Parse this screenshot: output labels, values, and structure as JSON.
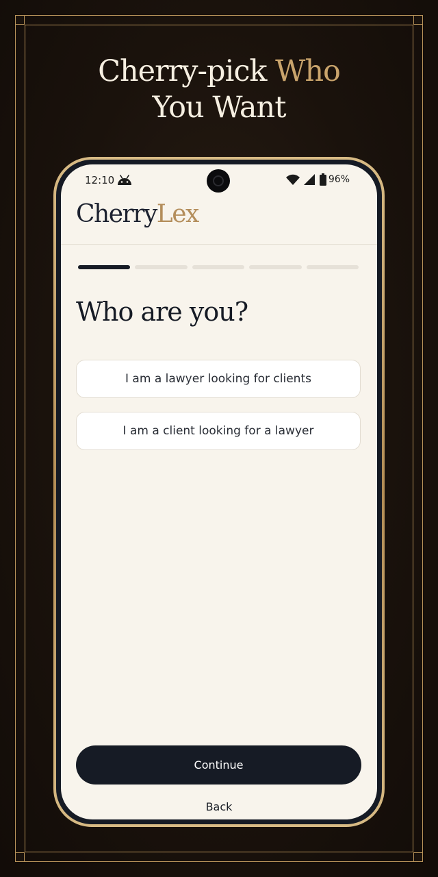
{
  "promo": {
    "headline_part1": "Cherry-pick",
    "headline_part2": "Who",
    "headline_line2": "You Want"
  },
  "status_bar": {
    "time": "12:10",
    "battery": "96%",
    "icons": [
      "android-icon",
      "wifi-icon",
      "cellular-signal-icon",
      "battery-icon"
    ]
  },
  "app": {
    "logo_part1": "Cherry",
    "logo_part2": "Lex",
    "progress": {
      "current_step": 1,
      "total_steps": 5
    },
    "question": "Who are you?",
    "options": [
      "I am a lawyer looking for clients",
      "I am a client looking for a lawyer"
    ],
    "continue_label": "Continue",
    "back_label": "Back"
  },
  "colors": {
    "background_dark": "#1a120c",
    "gold_accent": "#c9a46c",
    "screen_background": "#f8f4ec",
    "primary_dark": "#161b25"
  }
}
